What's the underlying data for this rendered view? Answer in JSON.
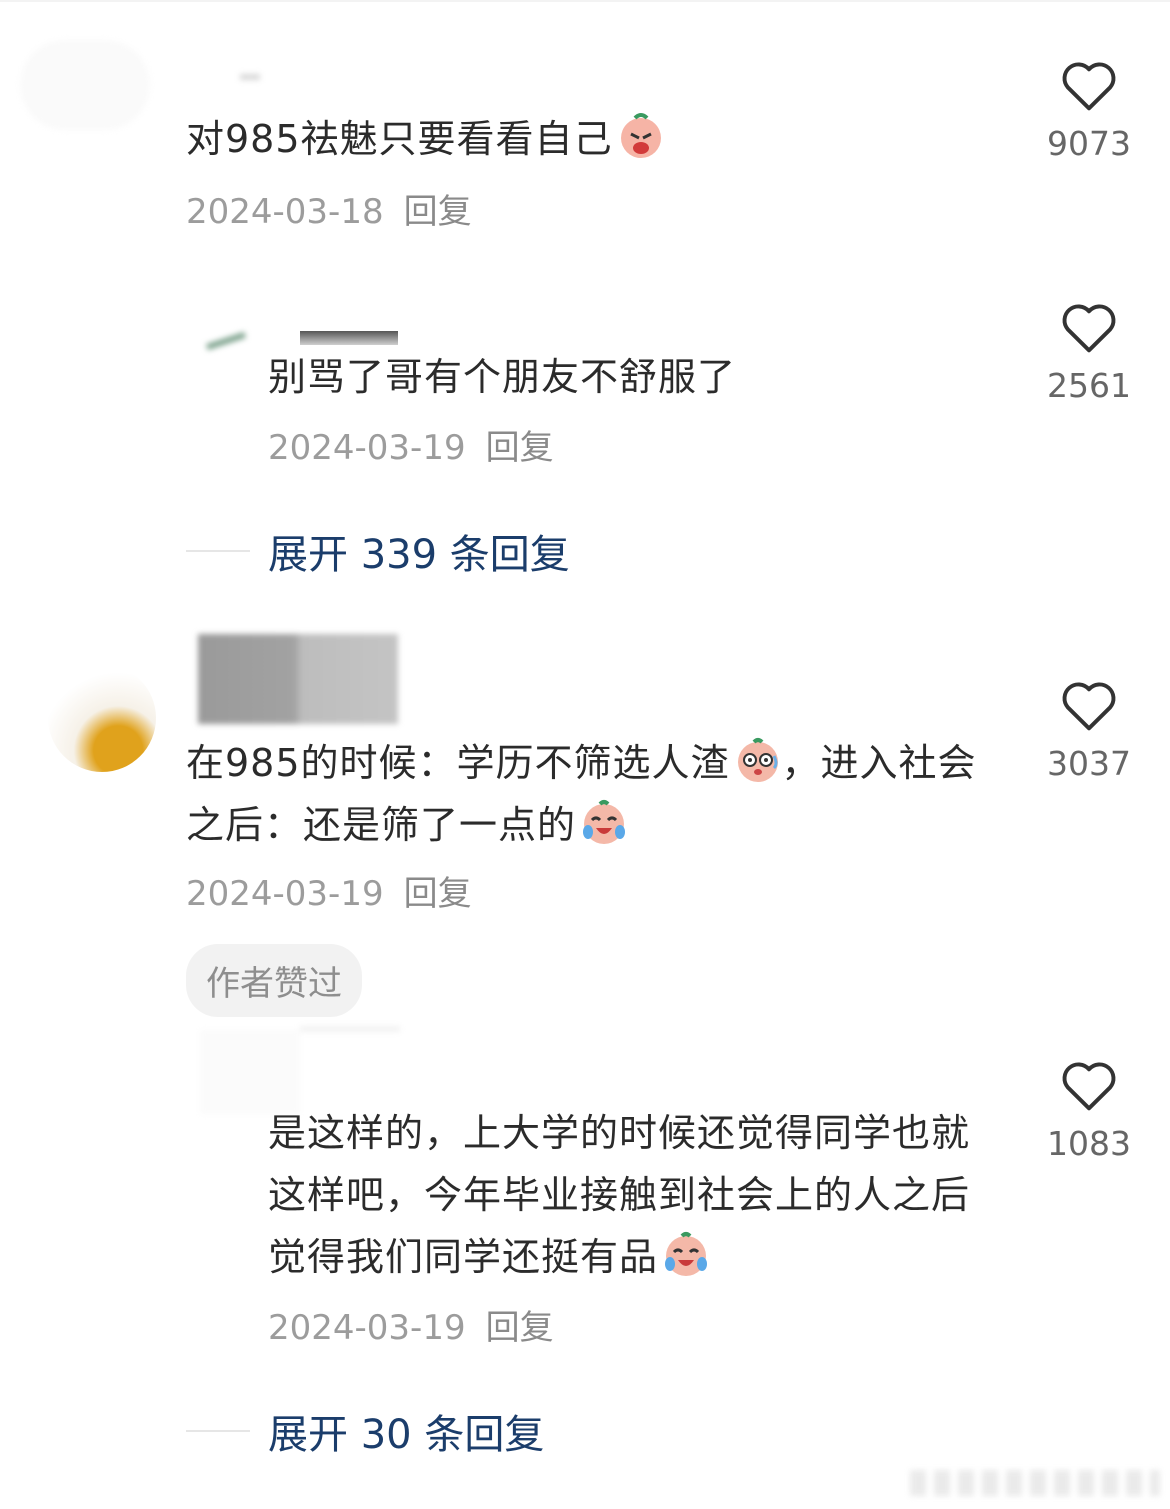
{
  "comments": [
    {
      "text": "对985祛魅只要看看自己",
      "date": "2024-03-18",
      "reply_label": "回复",
      "likes": "9073",
      "emoji": "crying-face-icon"
    },
    {
      "text": "别骂了哥有个朋友不舒服了",
      "date": "2024-03-19",
      "reply_label": "回复",
      "likes": "2561"
    },
    {
      "text_part1": "在985的时候：学历不筛选人渣",
      "text_part2": "，进入社会之后：还是筛了一点的",
      "date": "2024-03-19",
      "reply_label": "回复",
      "likes": "3037",
      "badge": "作者赞过",
      "emojis": [
        "dazed-face-icon",
        "laughing-tears-icon"
      ]
    },
    {
      "text": "是这样的，上大学的时候还觉得同学也就这样吧，今年毕业接触到社会上的人之后觉得我们同学还挺有品",
      "date": "2024-03-19",
      "reply_label": "回复",
      "likes": "1083",
      "emoji": "laughing-tears-icon"
    }
  ],
  "expand_1": "展开 339 条回复",
  "expand_2": "展开 30 条回复",
  "colors": {
    "link": "#1b3d6b",
    "meta": "#9c9c9c",
    "text": "#2b2b2b"
  }
}
